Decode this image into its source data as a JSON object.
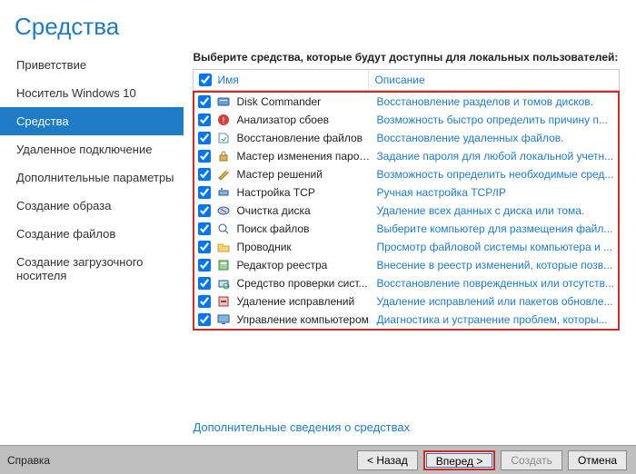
{
  "title": "Средства",
  "sidebar": {
    "items": [
      {
        "label": "Приветствие",
        "selected": false
      },
      {
        "label": "Носитель Windows 10",
        "selected": false
      },
      {
        "label": "Средства",
        "selected": true
      },
      {
        "label": "Удаленное подключение",
        "selected": false
      },
      {
        "label": "Дополнительные параметры",
        "selected": false
      },
      {
        "label": "Создание образа",
        "selected": false
      },
      {
        "label": "Создание файлов",
        "selected": false
      },
      {
        "label": "Создание загрузочного носителя",
        "selected": false
      }
    ]
  },
  "table": {
    "instruction": "Выберите средства, которые будут доступны для локальных пользователей:",
    "headers": {
      "name": "Имя",
      "description": "Описание"
    },
    "rows": [
      {
        "checked": true,
        "icon": "disk-commander-icon",
        "name": "Disk Commander",
        "description": "Восстановление разделов и томов дисков."
      },
      {
        "checked": true,
        "icon": "crash-analyzer-icon",
        "name": "Анализатор сбоев",
        "description": "Возможность быстро определить причину п..."
      },
      {
        "checked": true,
        "icon": "file-restore-icon",
        "name": "Восстановление файлов",
        "description": "Восстановление удаленных файлов."
      },
      {
        "checked": true,
        "icon": "locksmith-icon",
        "name": "Мастер изменения паролей",
        "description": "Задание пароля для любой локальной учетн..."
      },
      {
        "checked": true,
        "icon": "solution-wizard-icon",
        "name": "Мастер решений",
        "description": "Возможность определить необходимые сред..."
      },
      {
        "checked": true,
        "icon": "tcp-config-icon",
        "name": "Настройка TCP",
        "description": "Ручная настройка TCP/IP"
      },
      {
        "checked": true,
        "icon": "disk-wipe-icon",
        "name": "Очистка диска",
        "description": "Удаление всех данных с диска или тома."
      },
      {
        "checked": true,
        "icon": "file-search-icon",
        "name": "Поиск файлов",
        "description": "Выберите компьютер для размещения файл..."
      },
      {
        "checked": true,
        "icon": "explorer-icon",
        "name": "Проводник",
        "description": "Просмотр файловой системы компьютера и ..."
      },
      {
        "checked": true,
        "icon": "registry-editor-icon",
        "name": "Редактор реестра",
        "description": "Внесение в реестр изменений, которые позв..."
      },
      {
        "checked": true,
        "icon": "sfc-scan-icon",
        "name": "Средство проверки сист...",
        "description": "Восстановление поврежденных или отсутств..."
      },
      {
        "checked": true,
        "icon": "hotfix-uninstall-icon",
        "name": "Удаление исправлений",
        "description": "Удаление исправлений или пакетов обновле..."
      },
      {
        "checked": true,
        "icon": "computer-management-icon",
        "name": "Управление компьютером",
        "description": "Диагностика и устранение проблем, которы..."
      }
    ]
  },
  "link": "Дополнительные сведения о средствах",
  "footer": {
    "help": "Справка",
    "back": "< Назад",
    "next": "Вперед >",
    "create": "Создать",
    "cancel": "Отмена"
  }
}
